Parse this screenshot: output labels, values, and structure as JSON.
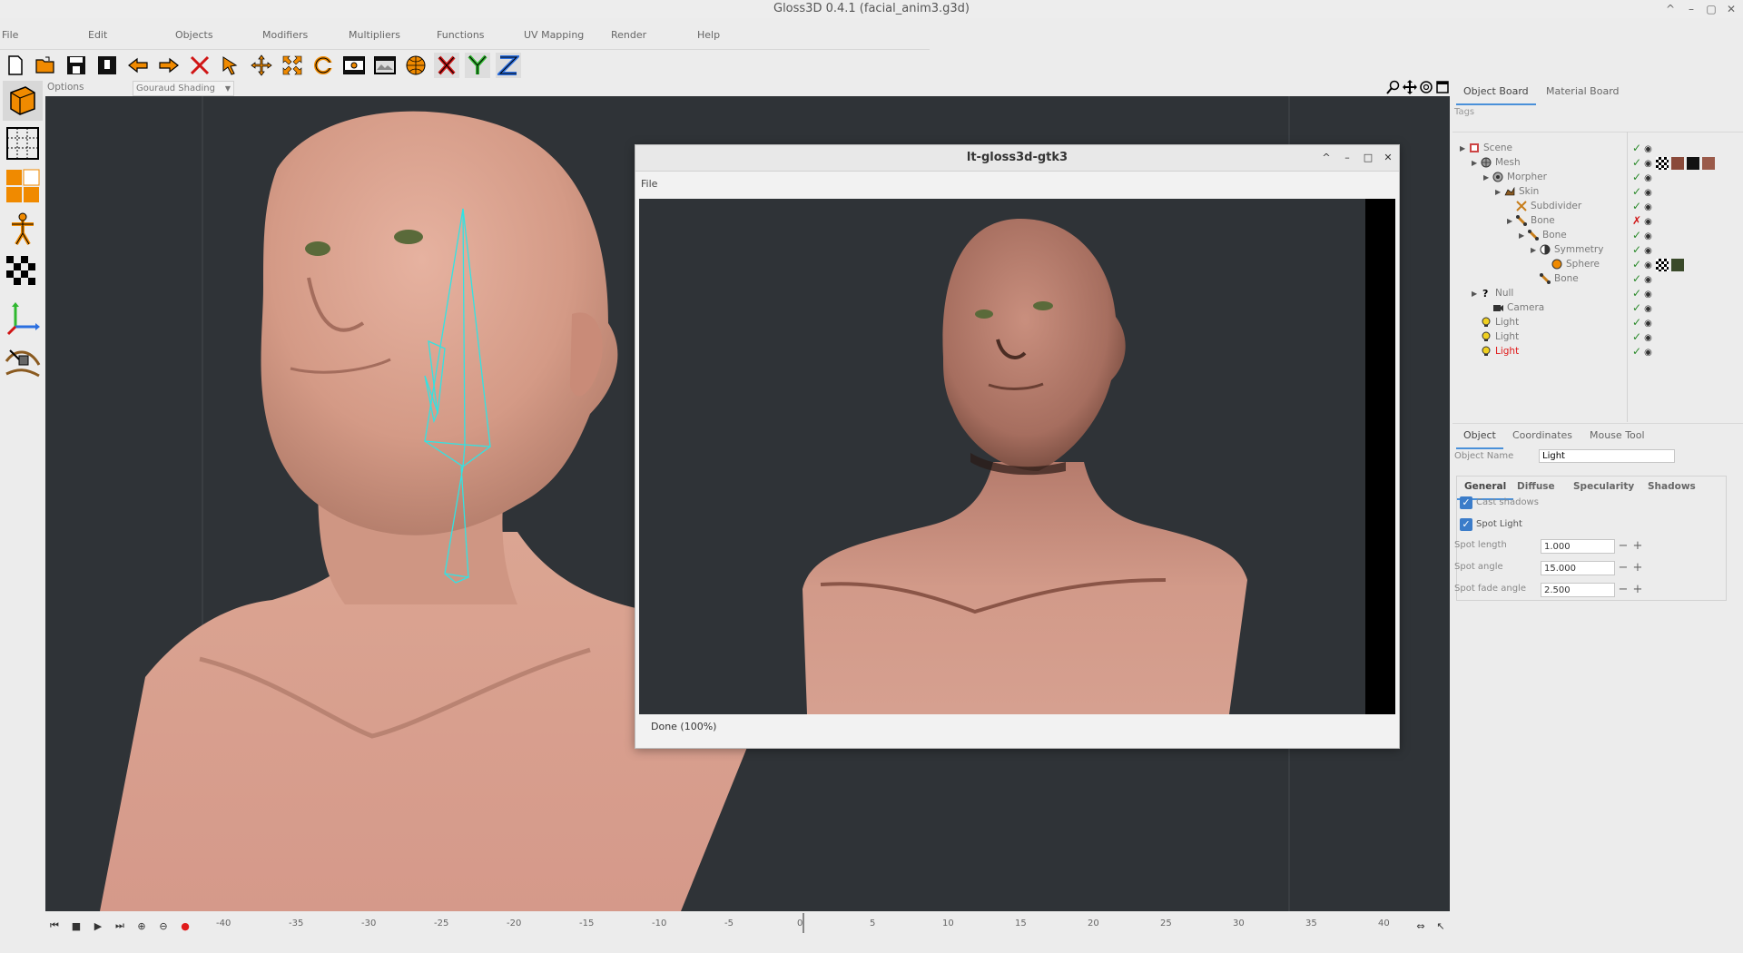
{
  "window": {
    "title": "Gloss3D 0.4.1 (facial_anim3.g3d)"
  },
  "menu": [
    "File",
    "Edit",
    "Objects",
    "Modifiers",
    "Multipliers",
    "Functions",
    "UV Mapping",
    "Render",
    "Help"
  ],
  "toolbar": {
    "icons": [
      "new-file-icon",
      "open-folder-icon",
      "save-icon",
      "save-as-icon",
      "undo-icon",
      "redo-icon",
      "delete-icon",
      "pick-tool-icon",
      "move-tool-icon",
      "scale-tool-icon",
      "rotate-tool-icon",
      "render-frame-icon",
      "render-view-icon",
      "sphere-render-icon",
      "x-axis-icon",
      "y-axis-icon",
      "z-axis-icon"
    ]
  },
  "left_tools": [
    "object-mode-icon",
    "vertex-mode-icon",
    "face-mode-icon",
    "skin-mode-icon",
    "uv-mode-icon",
    "axis-mode-icon",
    "sculpt-mode-icon"
  ],
  "options": {
    "label": "Options",
    "shading": "Gouraud Shading"
  },
  "timeline": {
    "ticks": [
      "-40",
      "-35",
      "-30",
      "-25",
      "-20",
      "-15",
      "-10",
      "-5",
      "0",
      "5",
      "10",
      "15",
      "20",
      "25",
      "30",
      "35",
      "40"
    ]
  },
  "render_window": {
    "title": "lt-gloss3d-gtk3",
    "menu_file": "File",
    "status": "Done (100%)"
  },
  "object_board": {
    "tabs": [
      "Object Board",
      "Material Board"
    ],
    "tags_label": "Tags",
    "tree": [
      {
        "label": "Scene",
        "depth": 0,
        "expander": true,
        "icon": "scene-icon",
        "color": "#7a7a7a",
        "active": true
      },
      {
        "label": "Mesh",
        "depth": 1,
        "expander": true,
        "icon": "mesh-icon",
        "color": "#7a7a7a",
        "active": true,
        "textures": true
      },
      {
        "label": "Morpher",
        "depth": 2,
        "expander": true,
        "icon": "morpher-icon",
        "color": "#7a7a7a",
        "active": true
      },
      {
        "label": "Skin",
        "depth": 3,
        "expander": true,
        "icon": "skin-icon",
        "color": "#7a7a7a",
        "active": true
      },
      {
        "label": "Subdivider",
        "depth": 4,
        "expander": false,
        "icon": "subdivider-icon",
        "color": "#7a7a7a",
        "active": true
      },
      {
        "label": "Bone",
        "depth": 4,
        "expander": true,
        "icon": "bone-icon",
        "color": "#7a7a7a",
        "active": false
      },
      {
        "label": "Bone",
        "depth": 5,
        "expander": true,
        "icon": "bone-icon",
        "color": "#7a7a7a",
        "active": true
      },
      {
        "label": "Symmetry",
        "depth": 6,
        "expander": true,
        "icon": "symmetry-icon",
        "color": "#7a7a7a",
        "active": true
      },
      {
        "label": "Sphere",
        "depth": 7,
        "expander": false,
        "icon": "sphere-icon",
        "color": "#7a7a7a",
        "active": true,
        "textures2": true
      },
      {
        "label": "Bone",
        "depth": 6,
        "expander": false,
        "icon": "bone-icon",
        "color": "#7a7a7a",
        "active": true
      },
      {
        "label": "Null",
        "depth": 1,
        "expander": true,
        "icon": "null-icon",
        "color": "#7a7a7a",
        "active": true
      },
      {
        "label": "Camera",
        "depth": 2,
        "expander": false,
        "icon": "camera-icon",
        "color": "#7a7a7a",
        "active": true
      },
      {
        "label": "Light",
        "depth": 1,
        "expander": false,
        "icon": "light-icon",
        "color": "#7a7a7a",
        "active": true
      },
      {
        "label": "Light",
        "depth": 1,
        "expander": false,
        "icon": "light-icon",
        "color": "#7a7a7a",
        "active": true
      },
      {
        "label": "Light",
        "depth": 1,
        "expander": false,
        "icon": "light-icon",
        "color": "#e01b1b",
        "active": true
      }
    ]
  },
  "properties": {
    "tabs": [
      "Object",
      "Coordinates",
      "Mouse Tool"
    ],
    "object_name_label": "Object Name",
    "object_name": "Light",
    "subtabs": [
      "General",
      "Diffuse",
      "Specularity",
      "Shadows"
    ],
    "cast_shadows": "Cast shadows",
    "spot_light": "Spot Light",
    "spot_length_label": "Spot length",
    "spot_length": "1.000",
    "spot_angle_label": "Spot angle",
    "spot_angle": "15.000",
    "spot_fade_label": "Spot fade angle",
    "spot_fade": "2.500"
  },
  "colors": {
    "viewport": "#2f3337",
    "skin": "#d9a290",
    "bone_wire": "#31e3e3",
    "accent": "#4a90d9",
    "toolbar_orange": "#f08a00"
  }
}
